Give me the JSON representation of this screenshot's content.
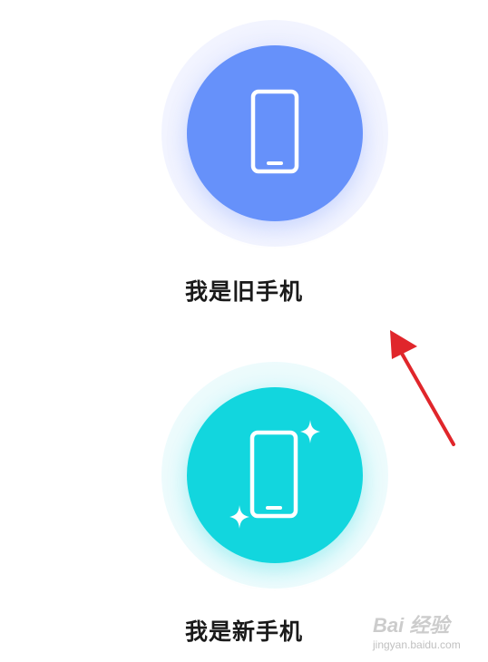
{
  "options": [
    {
      "label": "我是旧手机",
      "color": "#6691fa",
      "icon": "phone-icon"
    },
    {
      "label": "我是新手机",
      "color": "#12d6de",
      "icon": "phone-sparkle-icon"
    }
  ],
  "annotation": {
    "icon": "red-arrow-icon",
    "color": "#e0262b"
  },
  "watermark": {
    "text": "Bai 经验",
    "url_text": "jingyan.baidu.com"
  }
}
